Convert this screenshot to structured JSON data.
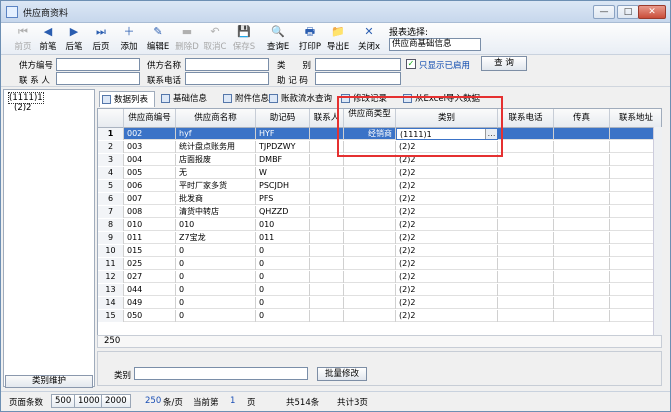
{
  "window": {
    "title": "供应商资料",
    "btn_min": "—",
    "btn_max": "□",
    "btn_close": "✕"
  },
  "toolbar": {
    "buttons": [
      {
        "id": "first",
        "label": "前页",
        "icon": "⏮",
        "disabled": true
      },
      {
        "id": "prev",
        "label": "前笔",
        "icon": "◀",
        "disabled": false
      },
      {
        "id": "next",
        "label": "后笔",
        "icon": "▶",
        "disabled": false
      },
      {
        "id": "last",
        "label": "后页",
        "icon": "⏭",
        "disabled": false
      },
      {
        "id": "add",
        "label": "添加",
        "icon": "＋",
        "disabled": false
      },
      {
        "id": "edit",
        "label": "编辑E",
        "icon": "✎",
        "disabled": false
      },
      {
        "id": "delete",
        "label": "删除D",
        "icon": "▬",
        "disabled": true
      },
      {
        "id": "cancel",
        "label": "取消C",
        "icon": "↶",
        "disabled": true
      },
      {
        "id": "save",
        "label": "保存S",
        "icon": "💾",
        "disabled": true
      },
      {
        "id": "query",
        "label": "查询E",
        "icon": "🔍",
        "disabled": false
      },
      {
        "id": "print",
        "label": "打印P",
        "icon": "🖶",
        "disabled": false
      },
      {
        "id": "export",
        "label": "导出E",
        "icon": "📁",
        "disabled": false
      },
      {
        "id": "close",
        "label": "关闭x",
        "icon": "✕",
        "disabled": false
      }
    ],
    "report_label": "报表选择:",
    "report_value": "供应商基础信息"
  },
  "filter": {
    "supplier_code_label": "供方编号",
    "supplier_name_label": "供方名称",
    "category_label": "类　　别",
    "contact_label": "联 系 人",
    "phone_label": "联系电话",
    "mnemonic_label": "助 记 码",
    "enabled_only_label": "只显示已启用",
    "enabled_only_checked": "✓",
    "query_button": "查 询"
  },
  "tree": {
    "items": [
      "(1111)1",
      "(2)2"
    ]
  },
  "tabs": [
    "数据列表",
    "基础信息",
    "附件信息",
    "账款流水查询",
    "修改记录",
    "从Excel导入数据"
  ],
  "grid": {
    "columns": [
      "",
      "供应商编号",
      "供应商名称",
      "助记码",
      "联系人",
      "供应商类型",
      "类别",
      "联系电话",
      "传真",
      "联系地址"
    ],
    "rows": [
      {
        "n": "1",
        "code": "002",
        "name": "hyf",
        "mnem": "HYF",
        "contact": "",
        "type": "经销商",
        "cat": "(1111)1"
      },
      {
        "n": "2",
        "code": "003",
        "name": "统计盘点账务用",
        "mnem": "TJPDZWY",
        "contact": "",
        "type": "",
        "cat": "(2)2"
      },
      {
        "n": "3",
        "code": "004",
        "name": "店面报废",
        "mnem": "DMBF",
        "contact": "",
        "type": "",
        "cat": "(2)2"
      },
      {
        "n": "4",
        "code": "005",
        "name": "无",
        "mnem": "W",
        "contact": "",
        "type": "",
        "cat": "(2)2"
      },
      {
        "n": "5",
        "code": "006",
        "name": "平时厂家多货",
        "mnem": "PSCJDH",
        "contact": "",
        "type": "",
        "cat": "(2)2"
      },
      {
        "n": "6",
        "code": "007",
        "name": "批发商",
        "mnem": "PFS",
        "contact": "",
        "type": "",
        "cat": "(2)2"
      },
      {
        "n": "7",
        "code": "008",
        "name": "清货中转店",
        "mnem": "QHZZD",
        "contact": "",
        "type": "",
        "cat": "(2)2"
      },
      {
        "n": "8",
        "code": "010",
        "name": "010",
        "mnem": "010",
        "contact": "",
        "type": "",
        "cat": "(2)2"
      },
      {
        "n": "9",
        "code": "011",
        "name": "Z7宝龙",
        "mnem": "011",
        "contact": "",
        "type": "",
        "cat": "(2)2"
      },
      {
        "n": "10",
        "code": "015",
        "name": "0",
        "mnem": "0",
        "contact": "",
        "type": "",
        "cat": "(2)2"
      },
      {
        "n": "11",
        "code": "025",
        "name": "0",
        "mnem": "0",
        "contact": "",
        "type": "",
        "cat": "(2)2"
      },
      {
        "n": "12",
        "code": "027",
        "name": "0",
        "mnem": "0",
        "contact": "",
        "type": "",
        "cat": "(2)2"
      },
      {
        "n": "13",
        "code": "044",
        "name": "0",
        "mnem": "0",
        "contact": "",
        "type": "",
        "cat": "(2)2"
      },
      {
        "n": "14",
        "code": "049",
        "name": "0",
        "mnem": "0",
        "contact": "",
        "type": "",
        "cat": "(2)2"
      },
      {
        "n": "15",
        "code": "050",
        "name": "0",
        "mnem": "0",
        "contact": "",
        "type": "",
        "cat": "(2)2"
      }
    ],
    "footer_count": "250",
    "combo_btn": "…"
  },
  "bottom": {
    "category_label": "类别",
    "batch_button": "批量修改",
    "category_maint": "类别维护"
  },
  "status": {
    "page_size_label": "页面条数",
    "sizes": [
      "500",
      "1000",
      "2000"
    ],
    "per_page": "250",
    "per_page_unit": "条/页",
    "current_label": "当前第",
    "current_page": "1",
    "page_unit": "页",
    "total_records": "共514条",
    "total_pages": "共计3页"
  }
}
